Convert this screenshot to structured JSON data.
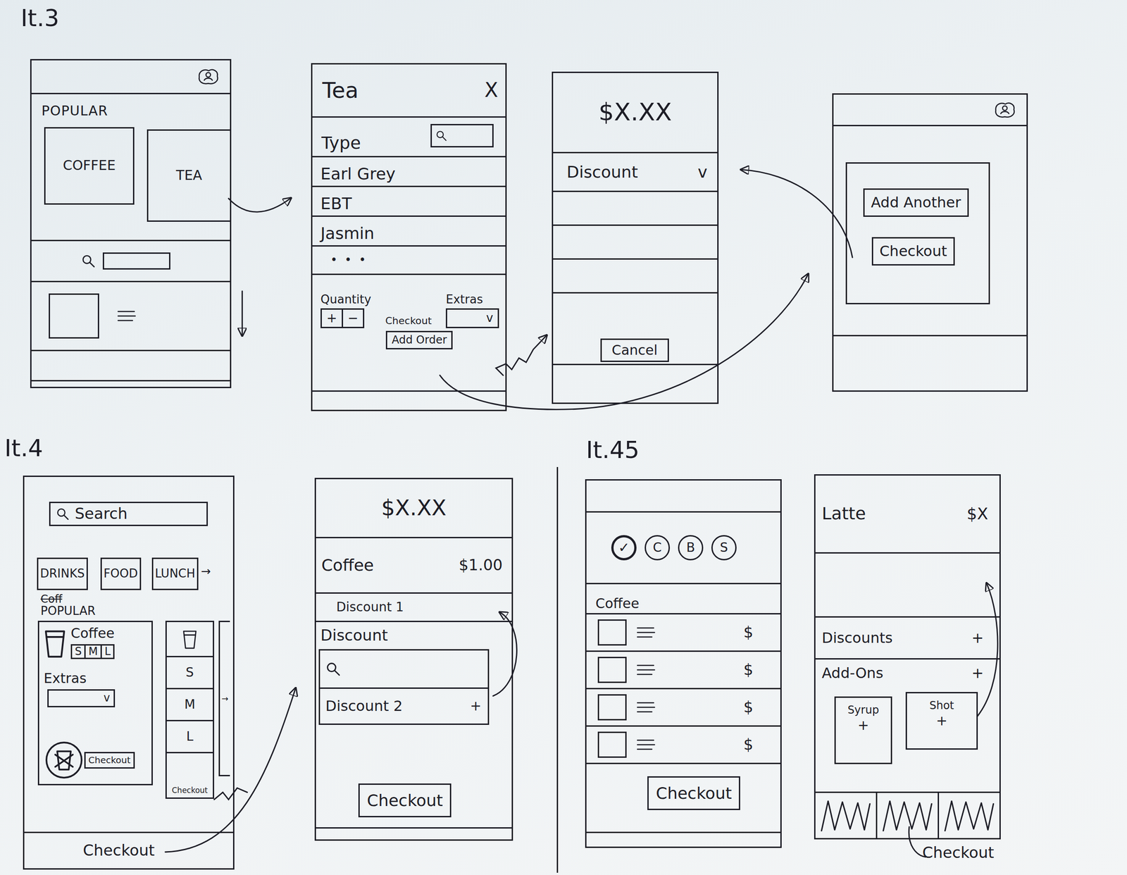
{
  "iterations": [
    {
      "label": "It.3",
      "screens": [
        {
          "kind": "home-v1",
          "popular": "POPULAR",
          "tiles": [
            "COFFEE",
            "TEA"
          ]
        },
        {
          "kind": "item-detail",
          "title": "Tea",
          "close": "X",
          "type_label": "Type",
          "options": [
            "Earl Grey",
            "EBT",
            "Jasmin"
          ],
          "more": "• • •",
          "quantity_label": "Quantity",
          "plus": "+",
          "minus": "−",
          "checkout": "Checkout",
          "extras_label": "Extras",
          "extras_caret": "v",
          "add_order": "Add Order"
        },
        {
          "kind": "payment-v1",
          "total": "$X.XX",
          "discount": "Discount",
          "discount_caret": "v",
          "cancel": "Cancel"
        },
        {
          "kind": "confirm",
          "buttons": [
            "Add Another",
            "Checkout"
          ]
        }
      ]
    },
    {
      "label": "It.4",
      "screens": [
        {
          "kind": "home-v2",
          "search": "Search",
          "categories": [
            "DRINKS",
            "FOOD",
            "LUNCH"
          ],
          "categories_arrow": "→",
          "struck": "Coff",
          "popular": "POPULAR",
          "card": {
            "title": "Coffee",
            "sizes": [
              "S",
              "M",
              "L"
            ],
            "extras": "Extras",
            "caret": "v",
            "checkout": "Checkout"
          },
          "side_card": {
            "sizes": [
              "S",
              "M",
              "L"
            ],
            "checkout": "Checkout",
            "arrow": "→"
          },
          "checkout": "Checkout"
        },
        {
          "kind": "payment-v2",
          "total": "$X.XX",
          "items": [
            {
              "name": "Coffee",
              "price": "$1.00"
            }
          ],
          "applied": [
            "Discount 1"
          ],
          "discount_label": "Discount",
          "results": [
            {
              "name": "Discount 2",
              "action": "+"
            }
          ],
          "checkout": "Checkout"
        }
      ]
    },
    {
      "label": "It.45",
      "screens": [
        {
          "kind": "menu",
          "filters": [
            {
              "label": "✓",
              "selected": true
            },
            {
              "label": "C",
              "selected": false
            },
            {
              "label": "B",
              "selected": false
            },
            {
              "label": "S",
              "selected": false
            }
          ],
          "section": "Coffee",
          "items": [
            {
              "price": "$"
            },
            {
              "price": "$"
            },
            {
              "price": "$"
            },
            {
              "price": "$"
            }
          ],
          "checkout": "Checkout"
        },
        {
          "kind": "item-v2",
          "title": "Latte",
          "price": "$X",
          "sections": [
            {
              "label": "Discounts",
              "action": "+"
            },
            {
              "label": "Add-Ons",
              "action": "+"
            }
          ],
          "addons": [
            {
              "label": "Syrup",
              "action": "+"
            },
            {
              "label": "Shot",
              "action": "+"
            }
          ],
          "checkout": "Checkout"
        }
      ]
    }
  ]
}
